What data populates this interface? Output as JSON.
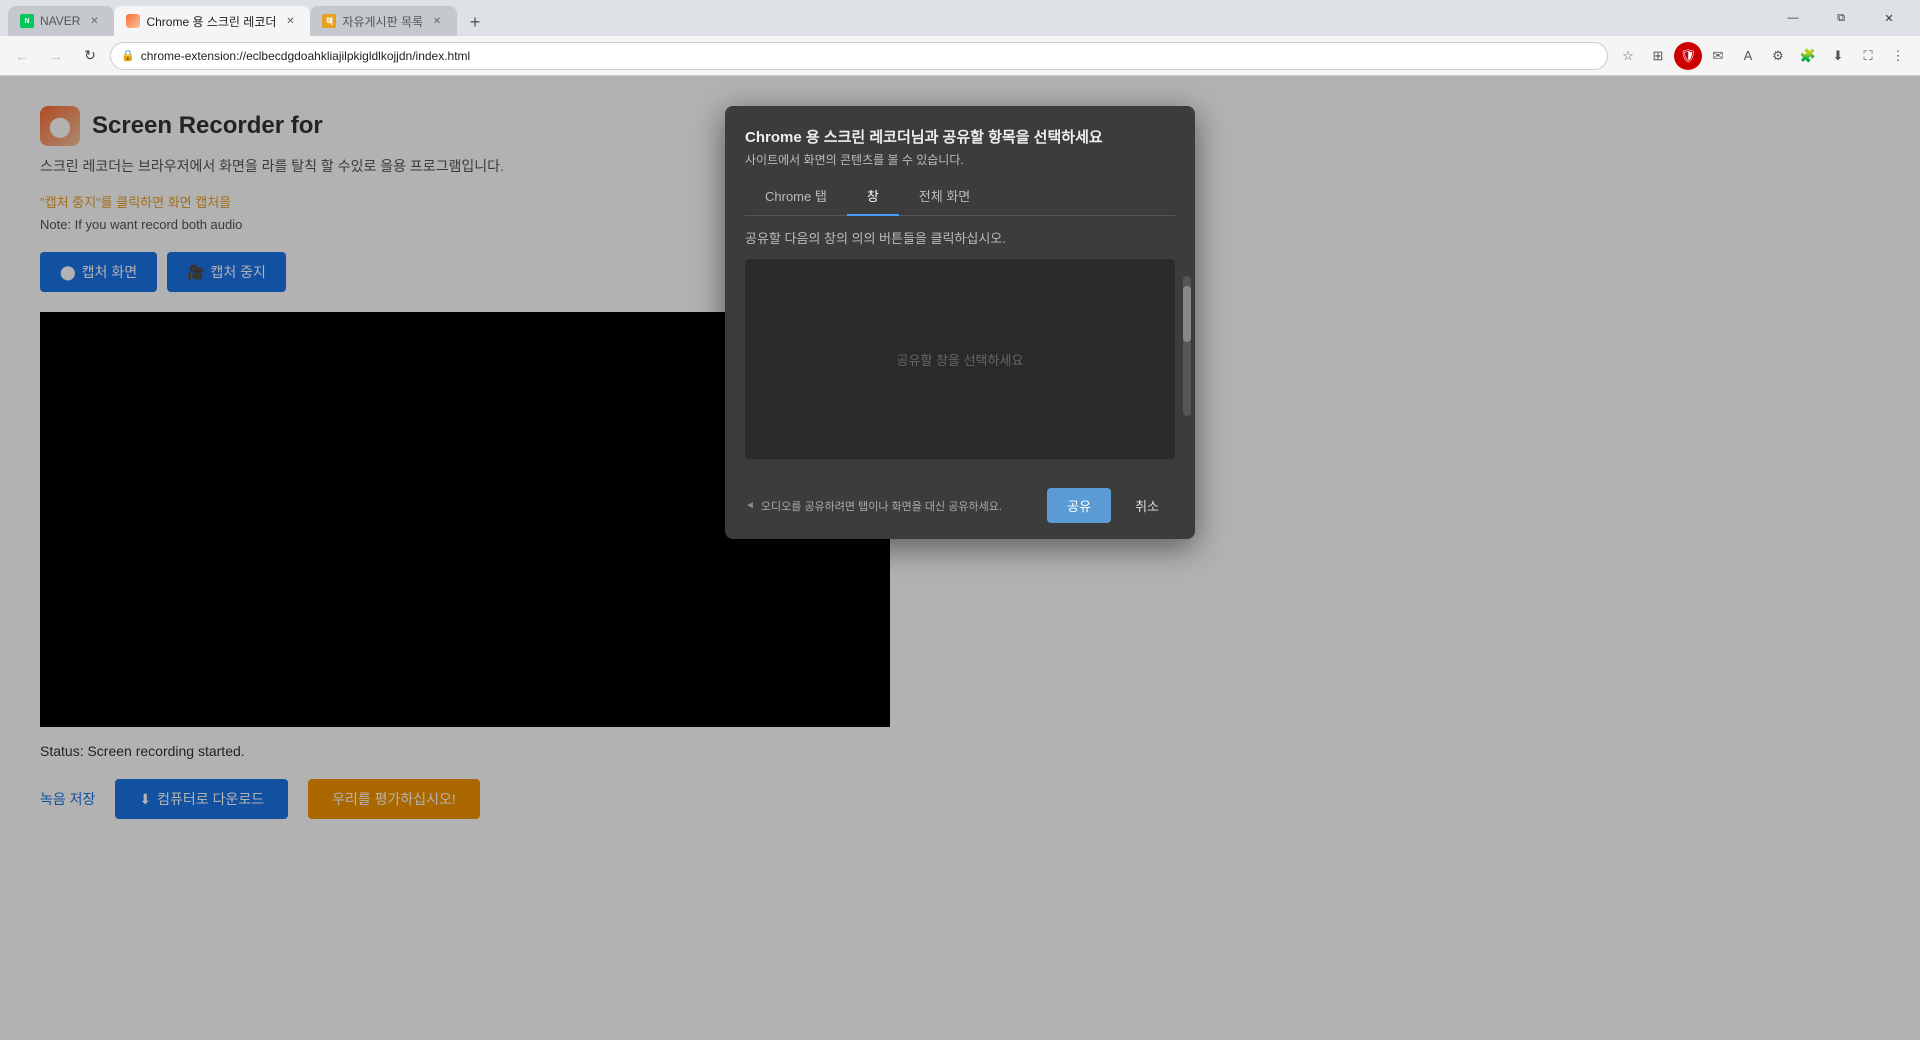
{
  "browser": {
    "tabs": [
      {
        "id": "naver",
        "title": "NAVER",
        "favicon_type": "naver",
        "active": false
      },
      {
        "id": "recorder",
        "title": "Chrome 용 스크린 레코더",
        "favicon_type": "recorder",
        "active": true
      },
      {
        "id": "bookmarks",
        "title": "자유게시판 목록",
        "favicon_type": "bookmark",
        "active": false
      }
    ],
    "new_tab_label": "+",
    "address_bar": {
      "url": "chrome-extension://eclbecdgdoahkliajilpkigldlkojjdn/index.html",
      "secure_icon": "🔒"
    },
    "window_controls": {
      "minimize": "—",
      "maximize": "❐",
      "restore": "⧉",
      "close": "✕"
    },
    "nav": {
      "back": "←",
      "forward": "→",
      "refresh": "↻",
      "home": "⌂"
    }
  },
  "page": {
    "title": "Screen Recorder for",
    "logo_icon": "●",
    "subtitle": "스크린 레코더는 브라우저에서 화면을 라를 탈칙 할 수있로 을용 프로그램입니다.",
    "capture_note": "\"캡처 중지\"를 클릭하면 화면 캡처을",
    "capture_note_en": "Note: If you want record both audio",
    "btn_capture": "캡처 화면",
    "btn_stop": "캡처 중지",
    "btn_capture_icon": "●",
    "btn_stop_icon": "🎥",
    "status": "Status: Screen recording started.",
    "link_save": "녹음 저장",
    "btn_download": "컴퓨터로 다운로드",
    "btn_download_icon": "⬇",
    "btn_rate": "우리를 평가하십시오!"
  },
  "modal": {
    "title": "Chrome 용 스크린 레코더님과 공유할 항목을 선택하세요",
    "subtitle": "사이트에서 화면의 콘텐츠를 볼 수 있습니다.",
    "tabs": [
      {
        "id": "chrome-tab",
        "label": "Chrome 탭",
        "active": false
      },
      {
        "id": "window",
        "label": "창",
        "active": true
      },
      {
        "id": "fullscreen",
        "label": "전체 화면",
        "active": false
      }
    ],
    "instruction": "공유할 다음의 창의 의의 버튼들을 클릭하십시오.",
    "content_placeholder": "공유할 창을 선택하세요",
    "audio_note": "오디오를 공유하려면 탭이나 화면을 대신 공유하세요.",
    "btn_share": "공유",
    "btn_cancel": "취소"
  },
  "colors": {
    "blue": "#1a73e8",
    "modal_bg": "#3c3c3c",
    "tab_active_line": "#4a9eff",
    "orange": "#f59500",
    "share_btn": "#5b9bd5"
  }
}
